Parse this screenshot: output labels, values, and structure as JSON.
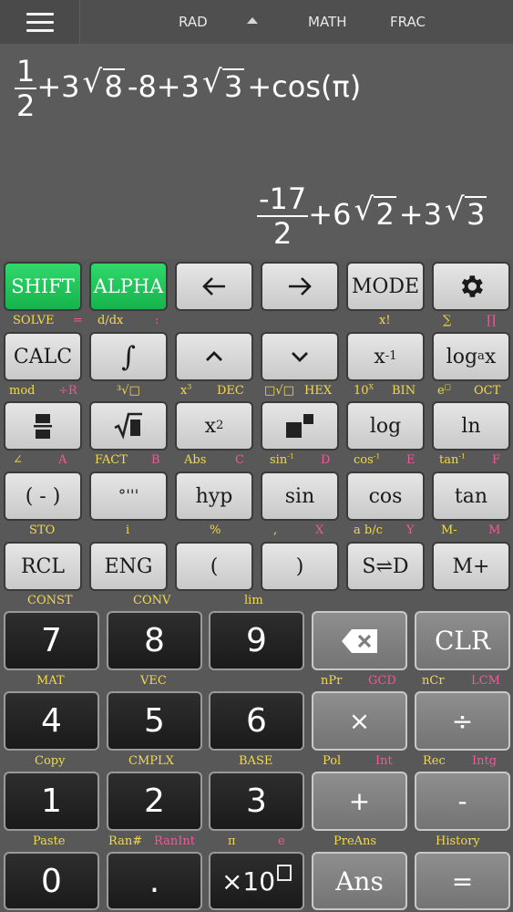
{
  "status": {
    "angle_mode": "RAD",
    "input_mode": "MATH",
    "result_mode": "FRAC"
  },
  "display": {
    "input": {
      "frac_num": "1",
      "frac_den": "2",
      "t1": "+3",
      "r1": "8",
      "t2": "-8+3",
      "r2": "3",
      "t3": "+cos(π)"
    },
    "result": {
      "frac_num": "-17",
      "frac_den": "2",
      "t1": "+6",
      "r1": "2",
      "t2": "+3",
      "r2": "3"
    }
  },
  "keys": {
    "shift": "SHIFT",
    "alpha": "ALPHA",
    "mode": "MODE",
    "calc": "CALC",
    "integral": "∫",
    "log": "log",
    "ln": "ln",
    "x2": "x",
    "x2_sup": "2",
    "xinv": "x",
    "xinv_sup": "-1",
    "logax_a": "log",
    "logax_b": "a",
    "logax_c": "x",
    "neg": "( - )",
    "dms": "°'''",
    "hyp": "hyp",
    "sin": "sin",
    "cos": "cos",
    "tan": "tan",
    "rcl": "RCL",
    "eng": "ENG",
    "lparen": "(",
    "rparen": ")",
    "sd": "S⇌D",
    "mplus": "M+",
    "n7": "7",
    "n8": "8",
    "n9": "9",
    "clr": "CLR",
    "n4": "4",
    "n5": "5",
    "n6": "6",
    "mul": "×",
    "div": "÷",
    "n1": "1",
    "n2": "2",
    "n3": "3",
    "add": "+",
    "sub": "-",
    "n0": "0",
    "dot": ".",
    "exp": "×10",
    "ans": "Ans",
    "eq": "="
  },
  "labels": {
    "solve": "SOLVE",
    "eq_small": "=",
    "ddx": "d/dx",
    "colon": ":",
    "fact_x": "x!",
    "sigma": "∑",
    "pi_prod": "∏",
    "mod": "mod",
    "divR": "÷R",
    "cuberoot": "³√□",
    "x3": "x",
    "x3_sup": "3",
    "dec": "DEC",
    "xroot": "□√□",
    "hex": "HEX",
    "tenx": "10",
    "tenx_sup": "X",
    "bin": "BIN",
    "ex": "e",
    "ex_sup": "□",
    "oct": "OCT",
    "angle": "∠",
    "A": "A",
    "fact": "FACT",
    "B": "B",
    "abs": "Abs",
    "C": "C",
    "asin": "sin",
    "asin_sup": "-1",
    "D": "D",
    "acos": "cos",
    "acos_sup": "-1",
    "E": "E",
    "atan": "tan",
    "atan_sup": "-1",
    "F": "F",
    "sto": "STO",
    "i": "i",
    "percent": "%",
    "comma": ",",
    "X": "X",
    "abc": "a b/c",
    "Y": "Y",
    "mminus": "M-",
    "M": "M",
    "const": "CONST",
    "conv": "CONV",
    "lim": "lim",
    "mat": "MAT",
    "vec": "VEC",
    "npr": "nPr",
    "gcd": "GCD",
    "ncr": "nCr",
    "lcm": "LCM",
    "copy": "Copy",
    "cmplx": "CMPLX",
    "base": "BASE",
    "pol": "Pol",
    "int": "Int",
    "rec": "Rec",
    "intg": "Intg",
    "paste": "Paste",
    "ran": "Ran#",
    "ranint": "RanInt",
    "pi": "π",
    "e": "e",
    "preans": "PreAns",
    "history": "History"
  }
}
